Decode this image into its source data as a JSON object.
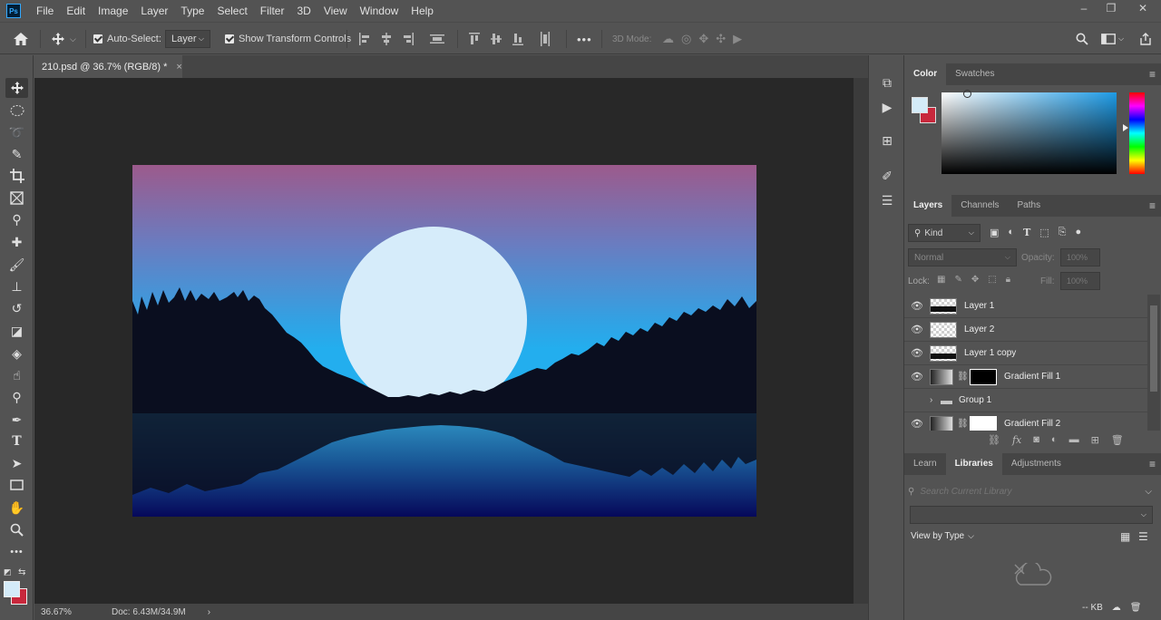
{
  "app": {
    "logo": "Ps"
  },
  "menu": [
    "File",
    "Edit",
    "Image",
    "Layer",
    "Type",
    "Select",
    "Filter",
    "3D",
    "View",
    "Window",
    "Help"
  ],
  "window_controls": {
    "minimize": "–",
    "restore": "❐",
    "close": "✕"
  },
  "options_bar": {
    "auto_select_label": "Auto-Select:",
    "auto_select_value": "Layer",
    "show_transform_label": "Show Transform Controls",
    "mode_3d_label": "3D Mode:",
    "more_label": "•••"
  },
  "document": {
    "tab_title": "210.psd @ 36.7% (RGB/8) *",
    "close": "×",
    "zoom": "36.67%",
    "doc_size": "Doc: 6.43M/34.9M"
  },
  "color_panel": {
    "tabs": [
      "Color",
      "Swatches"
    ],
    "foreground": "#d4ebf8",
    "background": "#c8283c"
  },
  "layers_panel": {
    "tabs": [
      "Layers",
      "Channels",
      "Paths"
    ],
    "filter_kind": "Kind",
    "blend_mode": "Normal",
    "opacity_label": "Opacity:",
    "opacity_value": "100%",
    "lock_label": "Lock:",
    "fill_label": "Fill:",
    "fill_value": "100%",
    "layers": [
      {
        "name": "Layer 1",
        "visible": true,
        "type": "pixel"
      },
      {
        "name": "Layer 2",
        "visible": true,
        "type": "pixel"
      },
      {
        "name": "Layer 1 copy",
        "visible": true,
        "type": "pixel"
      },
      {
        "name": "Gradient Fill 1",
        "visible": true,
        "type": "fill",
        "mask": "#000000"
      },
      {
        "name": "Group 1",
        "visible": false,
        "type": "group"
      },
      {
        "name": "Gradient Fill 2",
        "visible": true,
        "type": "fill",
        "mask": "#ffffff"
      }
    ]
  },
  "libraries_panel": {
    "tabs": [
      "Learn",
      "Libraries",
      "Adjustments"
    ],
    "search_placeholder": "Search Current Library",
    "view_by": "View by Type",
    "size": "-- KB"
  },
  "canvas_colors": {
    "sky_top": "#9a5a8e",
    "sky_mid": "#5b8ac8",
    "sky_low": "#29a6e6",
    "moon": "#d6ecfa",
    "silhouette": "#0a0e1e",
    "water_top": "#1f7bb0",
    "water_bottom": "#060a4a"
  }
}
